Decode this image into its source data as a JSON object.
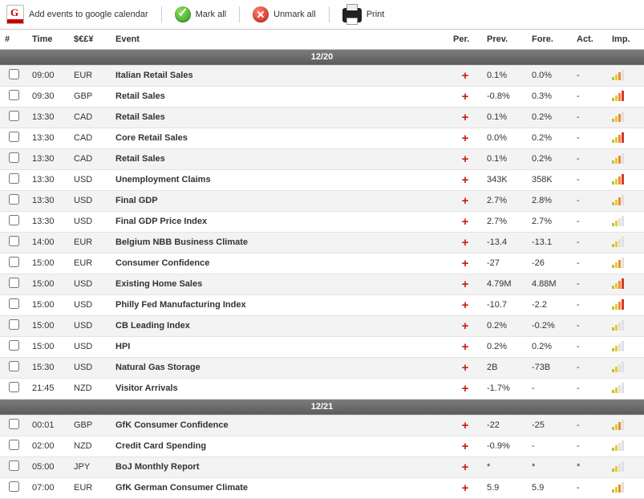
{
  "toolbar": {
    "add_google": "Add events to google calendar",
    "mark_all": "Mark all",
    "unmark_all": "Unmark all",
    "print": "Print"
  },
  "headers": {
    "num": "#",
    "time": "Time",
    "currency": "$€£¥",
    "event": "Event",
    "per": "Per.",
    "prev": "Prev.",
    "fore": "Fore.",
    "act": "Act.",
    "imp": "Imp."
  },
  "groups": [
    {
      "date": "12/20",
      "rows": [
        {
          "time": "09:00",
          "cur": "EUR",
          "event": "Italian Retail Sales",
          "prev": "0.1%",
          "fore": "0.0%",
          "act": "-",
          "imp": 3
        },
        {
          "time": "09:30",
          "cur": "GBP",
          "event": "Retail Sales",
          "prev": "-0.8%",
          "fore": "0.3%",
          "act": "-",
          "imp": 4
        },
        {
          "time": "13:30",
          "cur": "CAD",
          "event": "Retail Sales",
          "prev": "0.1%",
          "fore": "0.2%",
          "act": "-",
          "imp": 3
        },
        {
          "time": "13:30",
          "cur": "CAD",
          "event": "Core Retail Sales",
          "prev": "0.0%",
          "fore": "0.2%",
          "act": "-",
          "imp": 4
        },
        {
          "time": "13:30",
          "cur": "CAD",
          "event": "Retail Sales",
          "prev": "0.1%",
          "fore": "0.2%",
          "act": "-",
          "imp": 3
        },
        {
          "time": "13:30",
          "cur": "USD",
          "event": "Unemployment Claims",
          "prev": "343K",
          "fore": "358K",
          "act": "-",
          "imp": 4
        },
        {
          "time": "13:30",
          "cur": "USD",
          "event": "Final GDP",
          "prev": "2.7%",
          "fore": "2.8%",
          "act": "-",
          "imp": 3
        },
        {
          "time": "13:30",
          "cur": "USD",
          "event": "Final GDP Price Index",
          "prev": "2.7%",
          "fore": "2.7%",
          "act": "-",
          "imp": 2
        },
        {
          "time": "14:00",
          "cur": "EUR",
          "event": "Belgium NBB Business Climate",
          "prev": "-13.4",
          "fore": "-13.1",
          "act": "-",
          "imp": 2
        },
        {
          "time": "15:00",
          "cur": "EUR",
          "event": "Consumer Confidence",
          "prev": "-27",
          "fore": "-26",
          "act": "-",
          "imp": 3
        },
        {
          "time": "15:00",
          "cur": "USD",
          "event": "Existing Home Sales",
          "prev": "4.79M",
          "fore": "4.88M",
          "act": "-",
          "imp": 4
        },
        {
          "time": "15:00",
          "cur": "USD",
          "event": "Philly Fed Manufacturing Index",
          "prev": "-10.7",
          "fore": "-2.2",
          "act": "-",
          "imp": 4
        },
        {
          "time": "15:00",
          "cur": "USD",
          "event": "CB Leading Index",
          "prev": "0.2%",
          "fore": "-0.2%",
          "act": "-",
          "imp": 2
        },
        {
          "time": "15:00",
          "cur": "USD",
          "event": "HPI",
          "prev": "0.2%",
          "fore": "0.2%",
          "act": "-",
          "imp": 2
        },
        {
          "time": "15:30",
          "cur": "USD",
          "event": "Natural Gas Storage",
          "prev": "2B",
          "fore": "-73B",
          "act": "-",
          "imp": 2
        },
        {
          "time": "21:45",
          "cur": "NZD",
          "event": "Visitor Arrivals",
          "prev": "-1.7%",
          "fore": "-",
          "act": "-",
          "imp": 2
        }
      ]
    },
    {
      "date": "12/21",
      "rows": [
        {
          "time": "00:01",
          "cur": "GBP",
          "event": "GfK Consumer Confidence",
          "prev": "-22",
          "fore": "-25",
          "act": "-",
          "imp": 3
        },
        {
          "time": "02:00",
          "cur": "NZD",
          "event": "Credit Card Spending",
          "prev": "-0.9%",
          "fore": "-",
          "act": "-",
          "imp": 2
        },
        {
          "time": "05:00",
          "cur": "JPY",
          "event": "BoJ Monthly Report",
          "prev": "*",
          "fore": "*",
          "act": "*",
          "imp": 2
        },
        {
          "time": "07:00",
          "cur": "EUR",
          "event": "GfK German Consumer Climate",
          "prev": "5.9",
          "fore": "5.9",
          "act": "-",
          "imp": 3
        }
      ]
    }
  ]
}
